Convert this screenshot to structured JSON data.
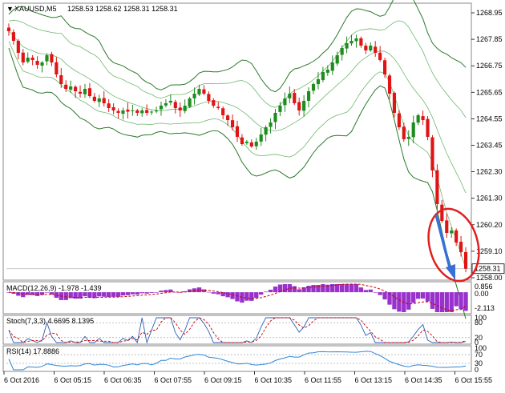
{
  "header": {
    "symbol": "XAUUSD,M5",
    "ohlc": "1258.53 1258.62 1258.31 1258.31"
  },
  "price_axis": {
    "ticks": [
      "1268.95",
      "1267.85",
      "1266.75",
      "1265.65",
      "1264.55",
      "1263.45",
      "1262.30",
      "1261.30",
      "1260.20",
      "1259.10",
      "1258.00"
    ],
    "current": "1258.31"
  },
  "macd": {
    "label": "MACD(12,26,9) -1.978 -1.439",
    "ticks": [
      "0.856",
      "0.00",
      "-2.113"
    ]
  },
  "stoch": {
    "label": "Stoch(7,3,3) 4.6695 8.1395",
    "ticks": [
      "100",
      "80",
      "20",
      "0"
    ]
  },
  "rsi": {
    "label": "RSI(14) 17.8886",
    "ticks": [
      "100",
      "70",
      "30",
      "0"
    ]
  },
  "time_axis": {
    "ticks": [
      "6 Oct 2016",
      "6 Oct 05:15",
      "6 Oct 06:35",
      "6 Oct 07:55",
      "6 Oct 09:15",
      "6 Oct 10:35",
      "6 Oct 11:55",
      "6 Oct 13:15",
      "6 Oct 14:35",
      "6 Oct 15:55"
    ]
  },
  "colors": {
    "up": "#1e8c1e",
    "down": "#e01414",
    "bands": "#2a7a2a",
    "macd_hist": "#9932cc",
    "signal": "#c00000",
    "annotation": "#e02020",
    "arrow": "#3a6fd8"
  },
  "chart_data": [
    {
      "type": "candlestick",
      "title": "XAUUSD,M5",
      "ylim": [
        1257.9,
        1269.3
      ],
      "x_ticks": [
        "6 Oct 2016",
        "6 Oct 05:15",
        "6 Oct 06:35",
        "6 Oct 07:55",
        "6 Oct 09:15",
        "6 Oct 10:35",
        "6 Oct 11:55",
        "6 Oct 13:15",
        "6 Oct 14:35",
        "6 Oct 15:55"
      ],
      "close_path": [
        1268.2,
        1267.8,
        1267.3,
        1266.9,
        1267.1,
        1267.0,
        1266.8,
        1266.9,
        1267.2,
        1266.9,
        1266.4,
        1266.0,
        1265.8,
        1265.9,
        1265.7,
        1265.6,
        1265.8,
        1265.5,
        1265.3,
        1265.4,
        1265.2,
        1265.0,
        1264.9,
        1264.8,
        1264.9,
        1264.85,
        1264.9,
        1264.8,
        1264.9,
        1264.8,
        1264.85,
        1264.9,
        1265.1,
        1265.2,
        1265.3,
        1265.0,
        1264.9,
        1265.1,
        1265.4,
        1265.6,
        1265.8,
        1265.6,
        1265.3,
        1265.1,
        1265.0,
        1264.7,
        1264.5,
        1264.2,
        1263.8,
        1263.5,
        1263.6,
        1263.4,
        1263.6,
        1263.9,
        1264.2,
        1264.4,
        1264.8,
        1265.1,
        1265.4,
        1265.6,
        1265.2,
        1264.9,
        1265.3,
        1265.7,
        1266.0,
        1266.2,
        1266.5,
        1266.6,
        1266.9,
        1267.2,
        1267.5,
        1267.7,
        1267.8,
        1267.9,
        1267.6,
        1267.4,
        1267.6,
        1267.3,
        1267.0,
        1266.4,
        1265.6,
        1264.8,
        1264.2,
        1263.7,
        1263.8,
        1264.4,
        1264.7,
        1264.5,
        1263.8,
        1262.4,
        1261.0,
        1260.3,
        1259.8,
        1259.9,
        1259.4,
        1259.0,
        1258.31
      ],
      "last_price": 1258.31,
      "annotation": "circle + downward arrow highlighting final sharp decline"
    },
    {
      "type": "bar",
      "title": "MACD(12,26,9) -1.978 -1.439",
      "ylim": [
        -2.113,
        0.856
      ],
      "macd_value": -1.978,
      "signal_value": -1.439
    },
    {
      "type": "line",
      "title": "Stoch(7,3,3) 4.6695 8.1395",
      "ylim": [
        0,
        100
      ],
      "levels": [
        80,
        20
      ],
      "k_value": 4.6695,
      "d_value": 8.1395
    },
    {
      "type": "line",
      "title": "RSI(14) 17.8886",
      "ylim": [
        0,
        100
      ],
      "levels": [
        70,
        30
      ],
      "value": 17.8886
    }
  ]
}
